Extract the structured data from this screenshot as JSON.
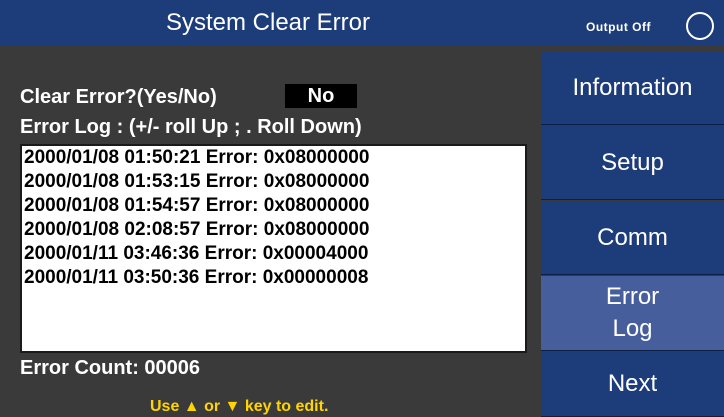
{
  "header": {
    "title": "System Clear Error",
    "output_status": "Output Off"
  },
  "clear_error": {
    "label": "Clear Error?(Yes/No)",
    "value": "No"
  },
  "log": {
    "label": "Error Log : (+/- roll Up ; . Roll Down)",
    "entries": [
      "2000/01/08  01:50:21 Error: 0x08000000",
      "2000/01/08  01:53:15 Error: 0x08000000",
      "2000/01/08  01:54:57 Error: 0x08000000",
      "2000/01/08  02:08:57 Error: 0x08000000",
      "2000/01/11  03:46:36 Error: 0x00004000",
      "2000/01/11  03:50:36 Error: 0x00000008"
    ]
  },
  "error_count": "Error Count: 00006",
  "hint": {
    "prefix": "Use ",
    "up": "▲",
    "middle": " or ",
    "down": "▼",
    "suffix": " key to edit."
  },
  "sidebar": {
    "information": "Information",
    "setup": "Setup",
    "comm": "Comm",
    "error_log_line1": "Error",
    "error_log_line2": "Log",
    "next": "Next"
  },
  "colors": {
    "title_bg": "#1d3c7a",
    "panel_bg": "#3a3a3a",
    "active_btn": "#465f9c",
    "hint": "#ffd400"
  }
}
